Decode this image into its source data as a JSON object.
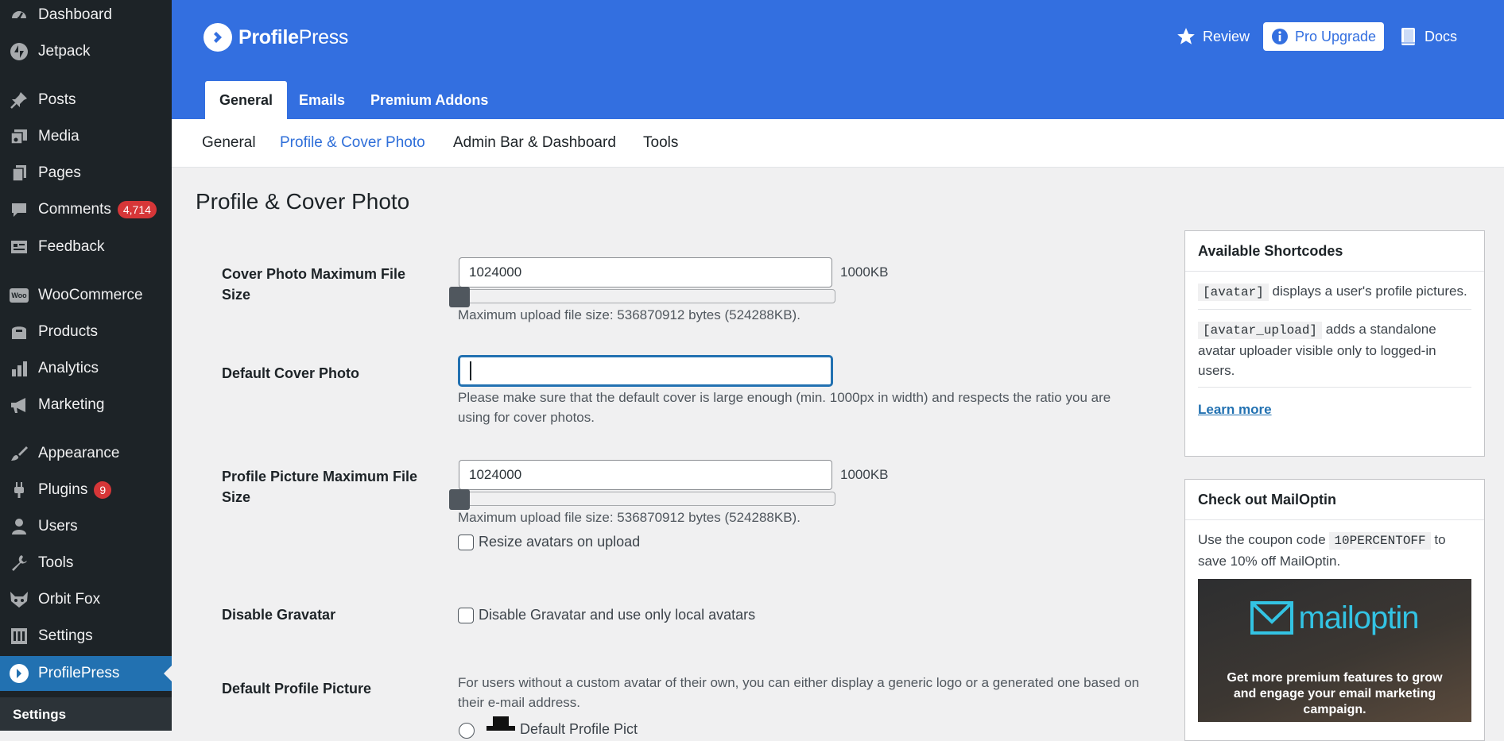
{
  "sidebar": {
    "items": [
      {
        "label": "Dashboard",
        "icon": "dashboard-icon"
      },
      {
        "label": "Jetpack",
        "icon": "jetpack-icon"
      },
      {
        "label": "Posts",
        "icon": "pin-icon"
      },
      {
        "label": "Media",
        "icon": "media-icon"
      },
      {
        "label": "Pages",
        "icon": "pages-icon"
      },
      {
        "label": "Comments",
        "icon": "comment-icon",
        "badge": "4,714"
      },
      {
        "label": "Feedback",
        "icon": "feedback-icon"
      },
      {
        "label": "WooCommerce",
        "icon": "woocommerce-icon",
        "icon_text": "Woo"
      },
      {
        "label": "Products",
        "icon": "archive-icon"
      },
      {
        "label": "Analytics",
        "icon": "bar-chart-icon"
      },
      {
        "label": "Marketing",
        "icon": "megaphone-icon"
      },
      {
        "label": "Appearance",
        "icon": "paintbrush-icon"
      },
      {
        "label": "Plugins",
        "icon": "plugin-icon",
        "badge": "9"
      },
      {
        "label": "Users",
        "icon": "user-icon"
      },
      {
        "label": "Tools",
        "icon": "wrench-icon"
      },
      {
        "label": "Orbit Fox",
        "icon": "fox-icon"
      },
      {
        "label": "Settings",
        "icon": "settings-icon"
      },
      {
        "label": "ProfilePress",
        "icon": "profilepress-icon"
      }
    ],
    "submenu_label": "Settings"
  },
  "header": {
    "brand_bold": "Profile",
    "brand_light": "Press",
    "review": "Review",
    "pro_upgrade": "Pro Upgrade",
    "docs": "Docs",
    "tabs": [
      "General",
      "Emails",
      "Premium Addons"
    ]
  },
  "subnav": [
    "General",
    "Profile & Cover Photo",
    "Admin Bar & Dashboard",
    "Tools"
  ],
  "page_title": "Profile & Cover Photo",
  "form": {
    "cover_max": {
      "label": "Cover Photo Maximum File Size",
      "value": "1024000",
      "unit": "1000KB",
      "slider_fraction": 0.0,
      "note": "Maximum upload file size: 536870912 bytes (524288KB)."
    },
    "default_cover": {
      "label": "Default Cover Photo",
      "value": "",
      "note": "Please make sure that the default cover is large enough (min. 1000px in width) and respects the ratio you are using for cover photos."
    },
    "profile_max": {
      "label": "Profile Picture Maximum File Size",
      "value": "1024000",
      "unit": "1000KB",
      "slider_fraction": 0.0,
      "note": "Maximum upload file size: 536870912 bytes (524288KB).",
      "resize_label": "Resize avatars on upload"
    },
    "gravatar": {
      "label": "Disable Gravatar",
      "checkbox_label": "Disable Gravatar and use only local avatars"
    },
    "default_profile": {
      "label": "Default Profile Picture",
      "note": "For users without a custom avatar of their own, you can either display a generic logo or a generated one based on their e-mail address.",
      "option_label": "Default Profile Pict"
    }
  },
  "panels": {
    "shortcodes": {
      "title": "Available Shortcodes",
      "items": [
        {
          "code": "[avatar]",
          "text": " displays a user's profile pictures."
        },
        {
          "code": "[avatar_upload]",
          "text": " adds a standalone avatar uploader visible only to logged-in users."
        }
      ],
      "learn_more": "Learn more"
    },
    "mailoptin": {
      "title": "Check out MailOptin",
      "text_before": "Use the coupon code ",
      "coupon": "10PERCENTOFF",
      "text_after": " to save 10% off MailOptin.",
      "banner_logo": "mailoptin",
      "banner_text": "Get more premium features to grow and engage your email marketing campaign."
    }
  },
  "colors": {
    "header_blue": "#336fe0",
    "sidebar_bg": "#1d2327",
    "active_menu": "#2271b1",
    "badge_red": "#d63638",
    "link_blue": "#2f6fd9"
  }
}
